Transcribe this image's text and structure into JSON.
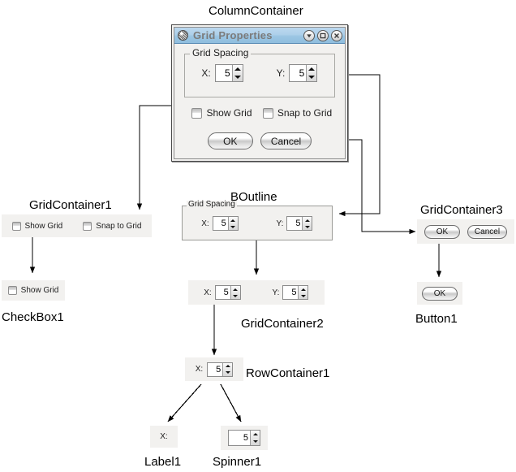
{
  "diagram": {
    "type": "ui-decomposition-tree",
    "background": "#ffffff",
    "node_labels": {
      "column_container": "ColumnContainer",
      "grid_container_1": "GridContainer1",
      "checkbox_1": "CheckBox1",
      "boutline": "BOutline",
      "grid_container_2": "GridContainer2",
      "grid_container_3": "GridContainer3",
      "button_1": "Button1",
      "row_container_1": "RowContainer1",
      "label_1": "Label1",
      "spinner_1": "Spinner1"
    }
  },
  "dialog": {
    "title": "Grid Properties",
    "title_icon": "app-pattern-icon",
    "titlebar_color": "#a6cce6",
    "title_text_color": "#7b7b7b",
    "window_buttons": [
      {
        "name": "minimize",
        "icon": "chevron-down-icon"
      },
      {
        "name": "maximize",
        "icon": "square-icon"
      },
      {
        "name": "close",
        "icon": "close-x-icon"
      }
    ],
    "group": {
      "title": "Grid Spacing",
      "fields": [
        {
          "label": "X:",
          "value": "5"
        },
        {
          "label": "Y:",
          "value": "5"
        }
      ]
    },
    "checkboxes": [
      {
        "label": "Show Grid",
        "checked": false
      },
      {
        "label": "Snap to Grid",
        "checked": false
      }
    ],
    "buttons": [
      {
        "label": "OK"
      },
      {
        "label": "Cancel"
      }
    ]
  },
  "grid_container_1": {
    "checkboxes": [
      {
        "label": "Show Grid",
        "checked": false
      },
      {
        "label": "Snap to Grid",
        "checked": false
      }
    ]
  },
  "checkbox_1": {
    "label": "Show Grid",
    "checked": false
  },
  "boutline": {
    "group_title": "Grid Spacing",
    "fields": [
      {
        "label": "X:",
        "value": "5"
      },
      {
        "label": "Y:",
        "value": "5"
      }
    ]
  },
  "grid_container_2": {
    "fields": [
      {
        "label": "X:",
        "value": "5"
      },
      {
        "label": "Y:",
        "value": "5"
      }
    ]
  },
  "grid_container_3": {
    "buttons": [
      {
        "label": "OK"
      },
      {
        "label": "Cancel"
      }
    ]
  },
  "button_1": {
    "label": "OK"
  },
  "row_container_1": {
    "field": {
      "label": "X:",
      "value": "5"
    }
  },
  "label_1": {
    "text": "X:"
  },
  "spinner_1": {
    "value": "5"
  }
}
